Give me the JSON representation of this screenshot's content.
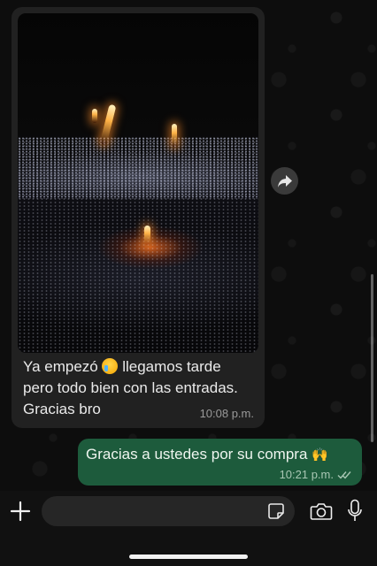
{
  "messages": {
    "incoming": {
      "text_part1": "Ya empezó",
      "text_part2": "llegamos tarde pero todo bien con las entradas. Gracias bro",
      "time": "10:08 p.m.",
      "emoji": "crying-face"
    },
    "outgoing": {
      "text": "Gracias a ustedes por su compra",
      "time": "10:21 p.m.",
      "emoji": "raised-hands",
      "status": "read"
    }
  },
  "input_bar": {
    "placeholder": "",
    "icons": [
      "plus-icon",
      "sticker-icon",
      "camera-icon",
      "microphone-icon"
    ]
  },
  "colors": {
    "incoming_bubble": "#212121",
    "outgoing_bubble": "#1d5b3c",
    "background": "#0d0d0d"
  }
}
